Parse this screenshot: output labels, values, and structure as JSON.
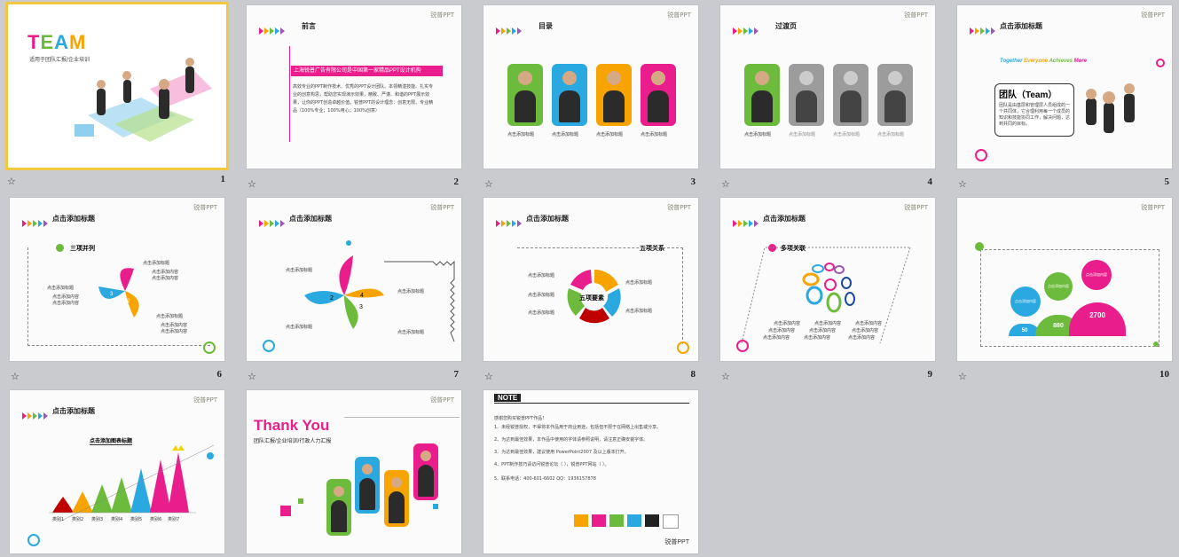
{
  "brand": "锐普PPT",
  "slides": [
    {
      "num": "1",
      "title": "TEAM",
      "subtitle": "适用于团队汇报/企业培训",
      "selected": true
    },
    {
      "num": "2",
      "title": "前言",
      "banner": "上海锐普广告有限公司是中国第一家精品PPT设计机构",
      "body": "高效专业的PPT制作技术、优秀的PPT设计团队、本领精湛技能、扎实专业的创意构思，帮助您实现演示效果，精致、严谨、和谐的PPT展示效果，让你的PPT创造卓越价值。锐普PPT的设计理念：创意无限、专业精品（100%专业；100%用心；100%创意）"
    },
    {
      "num": "3",
      "title": "目录",
      "captions": [
        "点击添加标题",
        "点击添加标题",
        "点击添加标题",
        "点击添加标题"
      ]
    },
    {
      "num": "4",
      "title": "过渡页",
      "captions": [
        "点击添加标题",
        "点击添加标题",
        "点击添加标题",
        "点击添加标题"
      ]
    },
    {
      "num": "5",
      "title": "点击添加标题",
      "words": [
        "Together",
        "Everyone",
        "Achieves",
        "More"
      ],
      "box_title": "团队（Team）",
      "box_text": "团队是由基层和管理层人员组成的一个共同体，它合理利用每一个成员的知识和技能协同工作，解决问题，达到共同的目标。"
    },
    {
      "num": "6",
      "title": "点击添加标题",
      "sub": "三项并列",
      "label": "点击添加标题",
      "items": [
        "点击添加内容",
        "点击添加内容",
        "点击添加内容"
      ]
    },
    {
      "num": "7",
      "title": "点击添加标题",
      "label": "点击添加标题"
    },
    {
      "num": "8",
      "title": "点击添加标题",
      "sub": "五项关系",
      "center": "五项要素",
      "label": "点击添加标题"
    },
    {
      "num": "9",
      "title": "点击添加标题",
      "sub": "多项关联",
      "item": "点击添加内容"
    },
    {
      "num": "10",
      "values": [
        "50",
        "880",
        "2700"
      ],
      "label": "点击添加内容"
    },
    {
      "num": "",
      "title": "点击添加标题",
      "sub": "点击添加图表标题",
      "cats": [
        "类别1",
        "类别2",
        "类别3",
        "类别4",
        "类别5",
        "类别6",
        "类别7"
      ]
    },
    {
      "num": "",
      "title": "Thank You",
      "subtitle": "团队汇报/企业培训/行政人力汇报"
    },
    {
      "num": "",
      "title": "NOTE",
      "intro": "感谢您购买锐普PPT作品！",
      "notes": [
        "1、未经锐普授权，不得将本作品用于商业用途，包括但不限于在网络上出售或分享。",
        "2、为达到最佳效果，本作品中使用的字体请参照说明，请注意正确安装字体。",
        "3、为达到最佳效果，建议使用 PowerPoint2007 及以上版本打开。",
        "4、PPT制作技巧请访问锐普论坛（ ），锐普PPT网站（ ）。",
        "5、联系电话：400-601-6602  QQ：1936157878"
      ],
      "colors": [
        "#f7a400",
        "#e91e8c",
        "#6dbb3c",
        "#2aa8e0",
        "#222222"
      ]
    }
  ]
}
